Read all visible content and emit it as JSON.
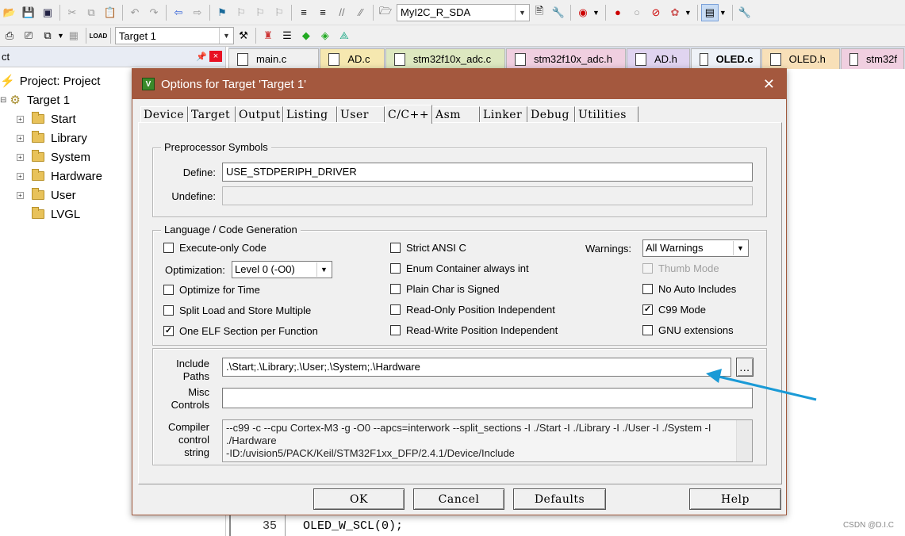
{
  "toolbar": {
    "target_file_combo": "MyI2C_R_SDA",
    "target_combo": "Target 1"
  },
  "project_panel": {
    "header": "ct",
    "items": [
      {
        "label": "Project: Project"
      },
      {
        "label": "Target 1"
      },
      {
        "label": "Start"
      },
      {
        "label": "Library"
      },
      {
        "label": "System"
      },
      {
        "label": "Hardware"
      },
      {
        "label": "User"
      },
      {
        "label": "LVGL"
      }
    ]
  },
  "file_tabs": [
    {
      "label": "main.c",
      "color": "#f0f0f0"
    },
    {
      "label": "AD.c",
      "color": "#f6e8b0"
    },
    {
      "label": "stm32f10x_adc.c",
      "color": "#dde8c0"
    },
    {
      "label": "stm32f10x_adc.h",
      "color": "#f0cfe0"
    },
    {
      "label": "AD.h",
      "color": "#e0d4f0"
    },
    {
      "label": "OLED.c",
      "color": "#eef2f8"
    },
    {
      "label": "OLED.h",
      "color": "#f8e0b8"
    },
    {
      "label": "stm32f",
      "color": "#f0cfe0"
    }
  ],
  "code": {
    "line_number": "35",
    "line_text": "OLED_W_SCL(0);"
  },
  "dialog": {
    "title": "Options for Target 'Target 1'",
    "tabs": [
      "Device",
      "Target",
      "Output",
      "Listing",
      "User",
      "C/C++",
      "Asm",
      "Linker",
      "Debug",
      "Utilities"
    ],
    "active_tab": "C/C++",
    "preprocessor": {
      "group_label": "Preprocessor Symbols",
      "define_label": "Define:",
      "define_value": "USE_STDPERIPH_DRIVER",
      "undefine_label": "Undefine:",
      "undefine_value": ""
    },
    "language": {
      "group_label": "Language / Code Generation",
      "execute_only": "Execute-only Code",
      "optimization_label": "Optimization:",
      "optimization_value": "Level 0 (-O0)",
      "optimize_time": "Optimize for Time",
      "split_load": "Split Load and Store Multiple",
      "one_elf": "One ELF Section per Function",
      "strict_ansi": "Strict ANSI C",
      "enum_container": "Enum Container always int",
      "plain_char": "Plain Char is Signed",
      "ro_position": "Read-Only Position Independent",
      "rw_position": "Read-Write Position Independent",
      "warnings_label": "Warnings:",
      "warnings_value": "All Warnings",
      "thumb_mode": "Thumb Mode",
      "no_auto_includes": "No Auto Includes",
      "c99_mode": "C99 Mode",
      "gnu_ext": "GNU extensions"
    },
    "include_label_1": "Include",
    "include_label_2": "Paths",
    "include_value": ".\\Start;.\\Library;.\\User;.\\System;.\\Hardware",
    "browse_label": "...",
    "misc_label_1": "Misc",
    "misc_label_2": "Controls",
    "misc_value": "",
    "compiler_label_1": "Compiler",
    "compiler_label_2": "control",
    "compiler_label_3": "string",
    "compiler_line_1": "--c99 -c --cpu Cortex-M3 -g -O0 --apcs=interwork --split_sections -I ./Start -I ./Library -I ./User -I ./System -I",
    "compiler_line_2": "./Hardware",
    "compiler_line_3": "-ID:/uvision5/PACK/Keil/STM32F1xx_DFP/2.4.1/Device/Include",
    "buttons": {
      "ok": "OK",
      "cancel": "Cancel",
      "defaults": "Defaults",
      "help": "Help"
    }
  },
  "watermark": "CSDN @D.I.C",
  "colors": {
    "dialog_title": "#a4583e",
    "arrow": "#1a9ad6"
  }
}
